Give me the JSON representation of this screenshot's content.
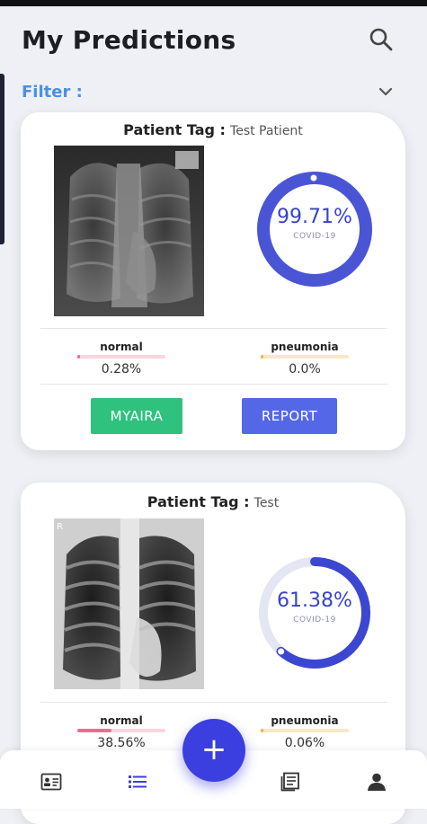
{
  "header": {
    "title": "My Predictions"
  },
  "filter": {
    "label": "Filter :"
  },
  "predictions": [
    {
      "tag_label": "Patient Tag :",
      "tag_value": "Test Patient",
      "confidence": "99.71%",
      "confidence_value": 0.9971,
      "diagnosis": "COVID-19",
      "metrics": [
        {
          "name": "normal",
          "value": "0.28%",
          "fraction": 0.0028,
          "color": "#f06b8f"
        },
        {
          "name": "pneumonia",
          "value": "0.0%",
          "fraction": 0.0,
          "color": "#f5b042"
        }
      ],
      "buttons": {
        "myaira": "MYAIRA",
        "report": "REPORT"
      }
    },
    {
      "tag_label": "Patient Tag :",
      "tag_value": "Test",
      "confidence": "61.38%",
      "confidence_value": 0.6138,
      "diagnosis": "COVID-19",
      "metrics": [
        {
          "name": "normal",
          "value": "38.56%",
          "fraction": 0.3856,
          "color": "#f06b8f"
        },
        {
          "name": "pneumonia",
          "value": "0.06%",
          "fraction": 0.0006,
          "color": "#f5b042"
        }
      ]
    }
  ],
  "nav": {
    "items": [
      "id-card-icon",
      "list-icon",
      "add-icon",
      "document-icon",
      "profile-icon"
    ],
    "fab_label": "+"
  },
  "colors": {
    "accent": "#3b3fe0",
    "filter": "#4a90e2",
    "donut_track": "#e4e6f3",
    "myaira": "#2ec27e",
    "report": "#5468e7"
  }
}
